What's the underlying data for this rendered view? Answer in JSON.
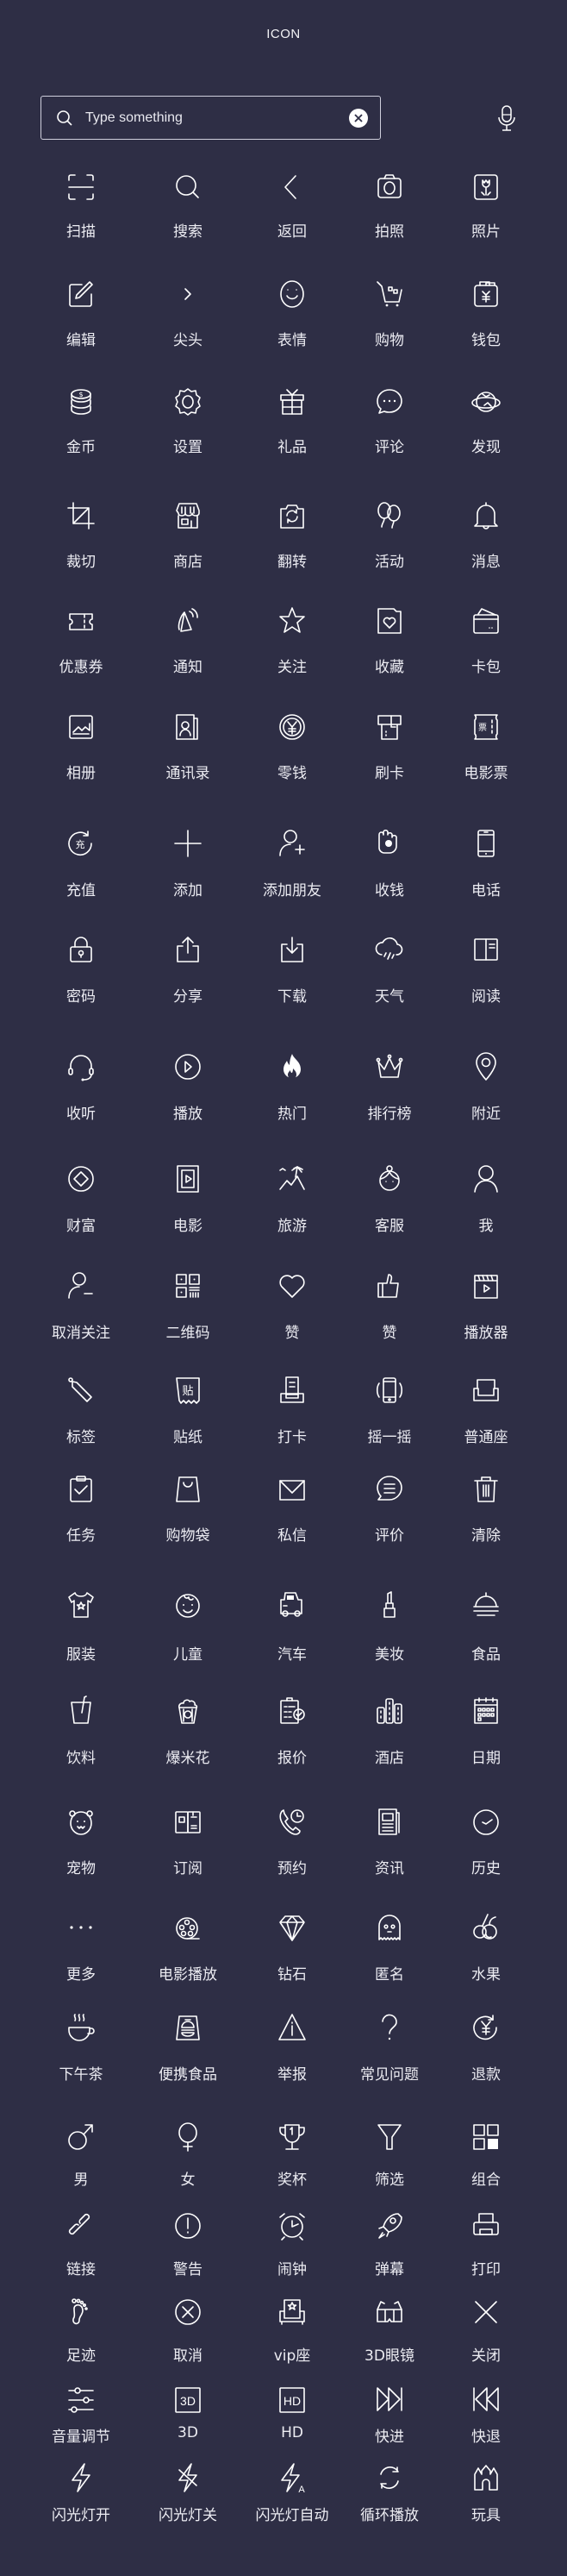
{
  "header": {
    "title": "ICON"
  },
  "search": {
    "placeholder": "Type something",
    "value": "",
    "search_icon": "search-icon",
    "clear_icon": "clear-icon",
    "mic_icon": "microphone-icon"
  },
  "colors": {
    "background": "#2e2e45",
    "foreground": "#f2f2f5"
  },
  "grid": [
    [
      {
        "label": "扫描",
        "icon": "scan"
      },
      {
        "label": "搜索",
        "icon": "search"
      },
      {
        "label": "返回",
        "icon": "back"
      },
      {
        "label": "拍照",
        "icon": "camera"
      },
      {
        "label": "照片",
        "icon": "photo"
      }
    ],
    [
      {
        "label": "编辑",
        "icon": "edit"
      },
      {
        "label": "尖头",
        "icon": "arrow-right"
      },
      {
        "label": "表情",
        "icon": "smile"
      },
      {
        "label": "购物",
        "icon": "cart"
      },
      {
        "label": "钱包",
        "icon": "wallet"
      }
    ],
    [
      {
        "label": "金币",
        "icon": "coins"
      },
      {
        "label": "设置",
        "icon": "gear"
      },
      {
        "label": "礼品",
        "icon": "gift"
      },
      {
        "label": "评论",
        "icon": "comment"
      },
      {
        "label": "发现",
        "icon": "planet"
      }
    ],
    [
      {
        "label": "裁切",
        "icon": "crop"
      },
      {
        "label": "商店",
        "icon": "shop"
      },
      {
        "label": "翻转",
        "icon": "flip-camera"
      },
      {
        "label": "活动",
        "icon": "balloons"
      },
      {
        "label": "消息",
        "icon": "bell"
      }
    ],
    [
      {
        "label": "优惠券",
        "icon": "coupon"
      },
      {
        "label": "通知",
        "icon": "notify"
      },
      {
        "label": "关注",
        "icon": "star"
      },
      {
        "label": "收藏",
        "icon": "favorite-folder"
      },
      {
        "label": "卡包",
        "icon": "card-wallet"
      }
    ],
    [
      {
        "label": "相册",
        "icon": "album"
      },
      {
        "label": "通讯录",
        "icon": "contacts"
      },
      {
        "label": "零钱",
        "icon": "yen-coin"
      },
      {
        "label": "刷卡",
        "icon": "card-swipe"
      },
      {
        "label": "电影票",
        "icon": "movie-ticket"
      }
    ],
    [
      {
        "label": "充值",
        "icon": "recharge"
      },
      {
        "label": "添加",
        "icon": "plus"
      },
      {
        "label": "添加朋友",
        "icon": "add-friend"
      },
      {
        "label": "收钱",
        "icon": "receive-money"
      },
      {
        "label": "电话",
        "icon": "phone"
      }
    ],
    [
      {
        "label": "密码",
        "icon": "lock"
      },
      {
        "label": "分享",
        "icon": "share"
      },
      {
        "label": "下载",
        "icon": "download"
      },
      {
        "label": "天气",
        "icon": "weather"
      },
      {
        "label": "阅读",
        "icon": "book"
      }
    ],
    [
      {
        "label": "收听",
        "icon": "headset"
      },
      {
        "label": "播放",
        "icon": "play-circle"
      },
      {
        "label": "热门",
        "icon": "fire"
      },
      {
        "label": "排行榜",
        "icon": "crown"
      },
      {
        "label": "附近",
        "icon": "location"
      }
    ],
    [
      {
        "label": "财富",
        "icon": "wealth"
      },
      {
        "label": "电影",
        "icon": "film"
      },
      {
        "label": "旅游",
        "icon": "travel"
      },
      {
        "label": "客服",
        "icon": "service"
      },
      {
        "label": "我",
        "icon": "user"
      }
    ],
    [
      {
        "label": "取消关注",
        "icon": "remove-user"
      },
      {
        "label": "二维码",
        "icon": "qrcode"
      },
      {
        "label": "赞",
        "icon": "heart"
      },
      {
        "label": "赞",
        "icon": "thumbs-up"
      },
      {
        "label": "播放器",
        "icon": "player"
      }
    ],
    [
      {
        "label": "标签",
        "icon": "tag"
      },
      {
        "label": "贴纸",
        "icon": "sticker"
      },
      {
        "label": "打卡",
        "icon": "clock-in"
      },
      {
        "label": "摇一摇",
        "icon": "shake"
      },
      {
        "label": "普通座",
        "icon": "seat"
      }
    ],
    [
      {
        "label": "任务",
        "icon": "task"
      },
      {
        "label": "购物袋",
        "icon": "shopping-bag"
      },
      {
        "label": "私信",
        "icon": "mail"
      },
      {
        "label": "评价",
        "icon": "review"
      },
      {
        "label": "清除",
        "icon": "trash"
      }
    ],
    [
      {
        "label": "服装",
        "icon": "clothes"
      },
      {
        "label": "儿童",
        "icon": "child"
      },
      {
        "label": "汽车",
        "icon": "car"
      },
      {
        "label": "美妆",
        "icon": "lipstick"
      },
      {
        "label": "食品",
        "icon": "food"
      }
    ],
    [
      {
        "label": "饮料",
        "icon": "drink"
      },
      {
        "label": "爆米花",
        "icon": "popcorn"
      },
      {
        "label": "报价",
        "icon": "quote"
      },
      {
        "label": "酒店",
        "icon": "hotel"
      },
      {
        "label": "日期",
        "icon": "calendar"
      }
    ],
    [
      {
        "label": "宠物",
        "icon": "pet"
      },
      {
        "label": "订阅",
        "icon": "subscribe"
      },
      {
        "label": "预约",
        "icon": "reservation"
      },
      {
        "label": "资讯",
        "icon": "news"
      },
      {
        "label": "历史",
        "icon": "history"
      }
    ],
    [
      {
        "label": "更多",
        "icon": "more"
      },
      {
        "label": "电影播放",
        "icon": "film-reel"
      },
      {
        "label": "钻石",
        "icon": "diamond"
      },
      {
        "label": "匿名",
        "icon": "ghost"
      },
      {
        "label": "水果",
        "icon": "fruit"
      }
    ],
    [
      {
        "label": "下午茶",
        "icon": "tea"
      },
      {
        "label": "便携食品",
        "icon": "portable-food"
      },
      {
        "label": "举报",
        "icon": "warning-triangle"
      },
      {
        "label": "常见问题",
        "icon": "question"
      },
      {
        "label": "退款",
        "icon": "refund"
      }
    ],
    [
      {
        "label": "男",
        "icon": "male"
      },
      {
        "label": "女",
        "icon": "female"
      },
      {
        "label": "奖杯",
        "icon": "trophy"
      },
      {
        "label": "筛选",
        "icon": "filter"
      },
      {
        "label": "组合",
        "icon": "combine"
      }
    ],
    [
      {
        "label": "链接",
        "icon": "link"
      },
      {
        "label": "警告",
        "icon": "alert"
      },
      {
        "label": "闹钟",
        "icon": "alarm"
      },
      {
        "label": "弹幕",
        "icon": "rocket"
      },
      {
        "label": "打印",
        "icon": "printer"
      }
    ],
    [
      {
        "label": "足迹",
        "icon": "footprint"
      },
      {
        "label": "取消",
        "icon": "cancel"
      },
      {
        "label": "vip座",
        "icon": "vip-seat"
      },
      {
        "label": "3D眼镜",
        "icon": "3d-glasses"
      },
      {
        "label": "关闭",
        "icon": "close"
      }
    ],
    [
      {
        "label": "音量调节",
        "icon": "sliders"
      },
      {
        "label": "3D",
        "icon": "3d"
      },
      {
        "label": "HD",
        "icon": "hd"
      },
      {
        "label": "快进",
        "icon": "fast-forward"
      },
      {
        "label": "快退",
        "icon": "rewind"
      }
    ],
    [
      {
        "label": "闪光灯开",
        "icon": "flash-on"
      },
      {
        "label": "闪光灯关",
        "icon": "flash-off"
      },
      {
        "label": "闪光灯自动",
        "icon": "flash-auto"
      },
      {
        "label": "循环播放",
        "icon": "loop"
      },
      {
        "label": "玩具",
        "icon": "toy-castle"
      }
    ]
  ]
}
